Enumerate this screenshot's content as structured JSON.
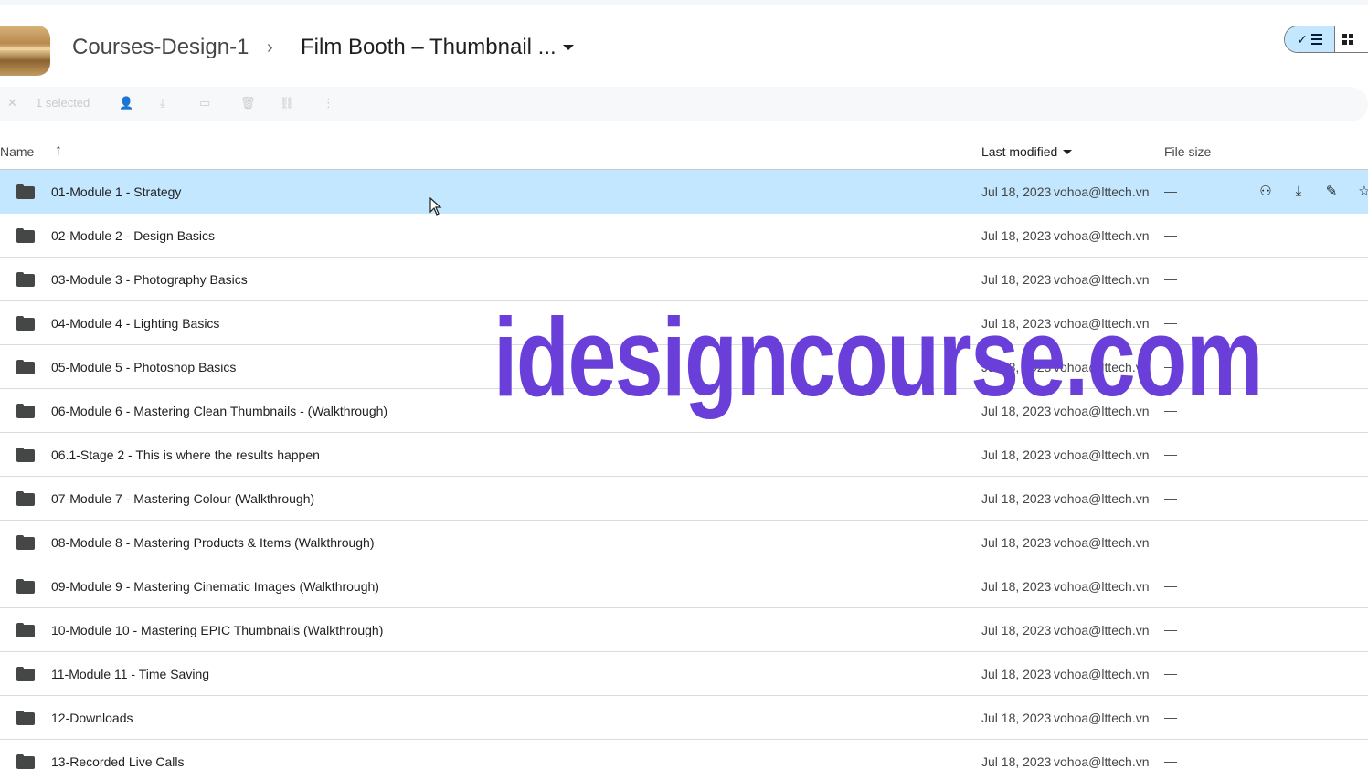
{
  "breadcrumb": {
    "parent": "Courses-Design-1",
    "separator": "›",
    "current": "Film Booth – Thumbnail ..."
  },
  "action_bar": {
    "selected_text": "1 selected",
    "icons": [
      "close-icon",
      "share-icon",
      "download-icon",
      "move-icon",
      "delete-icon",
      "link-icon",
      "more-icon"
    ]
  },
  "view_toggle": {
    "active": "list",
    "check": "✓"
  },
  "columns": {
    "name": "Name",
    "sort_arrow": "↑",
    "modified": "Last modified",
    "size": "File size"
  },
  "rows": [
    {
      "name": "01-Module 1 - Strategy",
      "date": "Jul 18, 2023",
      "owner": "vohoa@lttech.vn",
      "size": "—"
    },
    {
      "name": "02-Module 2 - Design Basics",
      "date": "Jul 18, 2023",
      "owner": "vohoa@lttech.vn",
      "size": "—"
    },
    {
      "name": "03-Module 3 - Photography Basics",
      "date": "Jul 18, 2023",
      "owner": "vohoa@lttech.vn",
      "size": "—"
    },
    {
      "name": "04-Module 4 - Lighting Basics",
      "date": "Jul 18, 2023",
      "owner": "vohoa@lttech.vn",
      "size": "—"
    },
    {
      "name": "05-Module 5 - Photoshop Basics",
      "date": "Jul 18, 2023",
      "owner": "vohoa@lttech.vn",
      "size": "—"
    },
    {
      "name": "06-Module 6 - Mastering Clean Thumbnails - (Walkthrough)",
      "date": "Jul 18, 2023",
      "owner": "vohoa@lttech.vn",
      "size": "—"
    },
    {
      "name": "06.1-Stage 2 - This is where the results happen",
      "date": "Jul 18, 2023",
      "owner": "vohoa@lttech.vn",
      "size": "—"
    },
    {
      "name": "07-Module 7 - Mastering Colour (Walkthrough)",
      "date": "Jul 18, 2023",
      "owner": "vohoa@lttech.vn",
      "size": "—"
    },
    {
      "name": "08-Module 8 - Mastering Products & Items (Walkthrough)",
      "date": "Jul 18, 2023",
      "owner": "vohoa@lttech.vn",
      "size": "—"
    },
    {
      "name": "09-Module 9 - Mastering Cinematic Images (Walkthrough)",
      "date": "Jul 18, 2023",
      "owner": "vohoa@lttech.vn",
      "size": "—"
    },
    {
      "name": "10-Module 10 - Mastering EPIC Thumbnails (Walkthrough)",
      "date": "Jul 18, 2023",
      "owner": "vohoa@lttech.vn",
      "size": "—"
    },
    {
      "name": "11-Module 11 - Time Saving",
      "date": "Jul 18, 2023",
      "owner": "vohoa@lttech.vn",
      "size": "—"
    },
    {
      "name": "12-Downloads",
      "date": "Jul 18, 2023",
      "owner": "vohoa@lttech.vn",
      "size": "—"
    },
    {
      "name": "13-Recorded Live Calls",
      "date": "Jul 18, 2023",
      "owner": "vohoa@lttech.vn",
      "size": "—"
    }
  ],
  "selected_row_actions": [
    "share-person-icon",
    "download-icon",
    "rename-icon",
    "star-icon"
  ],
  "watermark": "idesigncourse.com",
  "colors": {
    "selected_row": "#c2e7ff",
    "watermark": "#6a3ed8",
    "toggle_active": "#c2e7ff"
  }
}
